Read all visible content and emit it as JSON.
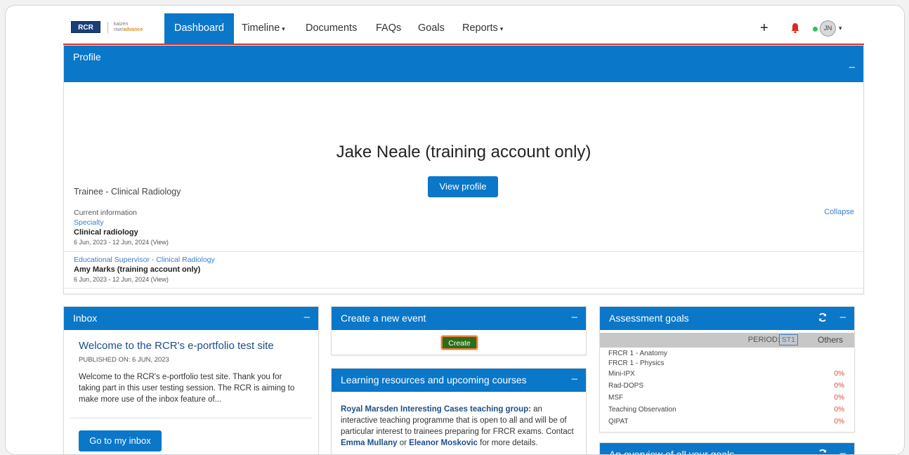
{
  "nav": {
    "logo_text": "RCR",
    "kaizen_line1": "kaizen",
    "kaizen_line2a": "rise/",
    "kaizen_line2b": "advance",
    "items": [
      {
        "label": "Dashboard"
      },
      {
        "label": "Timeline"
      },
      {
        "label": "Documents"
      },
      {
        "label": "FAQs"
      },
      {
        "label": "Goals"
      },
      {
        "label": "Reports"
      }
    ],
    "plus": "+",
    "avatar_initials": "JN",
    "caret": "▾"
  },
  "profile": {
    "title": "Profile",
    "collapse": "–",
    "name": "Jake Neale (training account only)",
    "role": "Trainee - Clinical Radiology",
    "view_profile": "View profile",
    "current_info": "Current information",
    "collapse_link": "Collapse",
    "specialty_label": "Specialty",
    "specialty_value": "Clinical radiology",
    "specialty_dates": "6 Jun, 2023 - 12 Jun, 2024 (View)",
    "supervisor_label": "Educational Supervisor - Clinical Radiology",
    "supervisor_value": "Amy Marks (training account only)",
    "supervisor_dates": "6 Jun, 2023 - 12 Jun, 2024 (View)"
  },
  "inbox": {
    "title": "Inbox",
    "collapse": "–",
    "message_title": "Welcome to the RCR's e-portfolio test site",
    "published": "PUBLISHED ON: 6 JUN, 2023",
    "body": "Welcome to the RCR's e-portfolio test site. Thank you for taking part in this user testing session. The RCR is aiming to make more use of the inbox feature of...",
    "button": "Go to my inbox"
  },
  "event": {
    "title": "Create a new event",
    "collapse": "–",
    "button": "Create"
  },
  "learning": {
    "title": "Learning resources and upcoming courses",
    "collapse": "–",
    "hl1": "Royal Marsden Interesting Cases teaching group:",
    "text1": " an interactive teaching programme that is open to all and will be of particular interest to trainees preparing for FRCR exams. Contact ",
    "hl2": "Emma Mullany",
    "text2": " or ",
    "hl3": "Eleanor Moskovic",
    "text3": " for more details."
  },
  "goals": {
    "title": "Assessment goals",
    "collapse": "–",
    "period_label": "PERIOD:",
    "period_current": "ST1",
    "period_others": "Others",
    "rows": [
      {
        "name": "FRCR 1 - Anatomy",
        "pct": ""
      },
      {
        "name": "FRCR 1 - Physics",
        "pct": ""
      },
      {
        "name": "Mini-IPX",
        "pct": "0%"
      },
      {
        "name": "Rad-DOPS",
        "pct": "0%"
      },
      {
        "name": "MSF",
        "pct": "0%"
      },
      {
        "name": "Teaching Observation",
        "pct": "0%"
      },
      {
        "name": "QIPAT",
        "pct": "0%"
      }
    ]
  },
  "overview": {
    "title": "An overview of all your goals",
    "collapse": "–"
  },
  "colors": {
    "primary": "#0a77c9",
    "nav_underline": "#d9342b",
    "create_green": "#2a6e1b",
    "highlight_orange": "#f07b3c",
    "percent_red": "#e0473a"
  }
}
